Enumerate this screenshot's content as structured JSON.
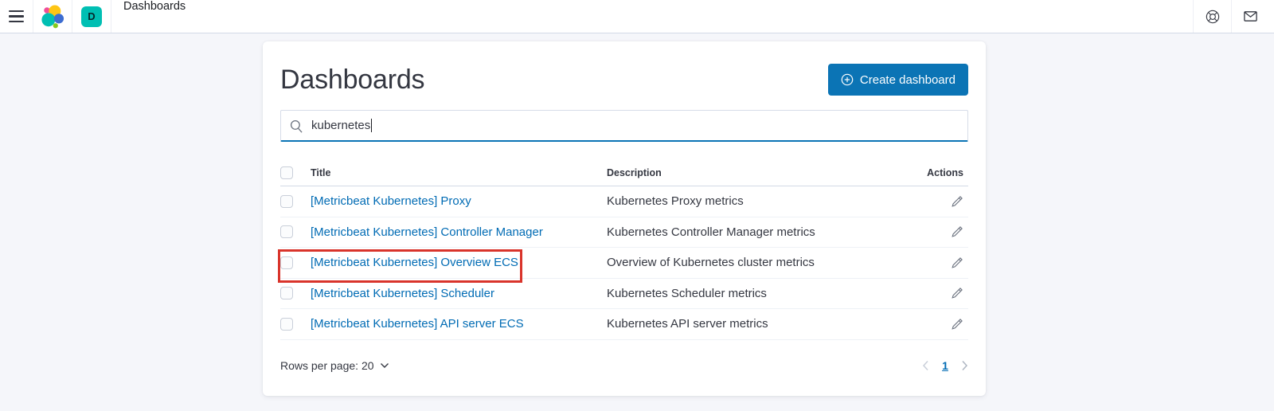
{
  "topbar": {
    "breadcrumb": "Dashboards",
    "space_badge": "D"
  },
  "main": {
    "title": "Dashboards",
    "create_button": "Create dashboard",
    "search_value": "kubernetes"
  },
  "table": {
    "columns": {
      "title": "Title",
      "description": "Description",
      "actions": "Actions"
    },
    "rows": [
      {
        "title": "[Metricbeat Kubernetes] Proxy",
        "description": "Kubernetes Proxy metrics",
        "highlighted": false
      },
      {
        "title": "[Metricbeat Kubernetes] Controller Manager",
        "description": "Kubernetes Controller Manager metrics",
        "highlighted": false
      },
      {
        "title": "[Metricbeat Kubernetes] Overview ECS",
        "description": "Overview of Kubernetes cluster metrics",
        "highlighted": true
      },
      {
        "title": "[Metricbeat Kubernetes] Scheduler",
        "description": "Kubernetes Scheduler metrics",
        "highlighted": false
      },
      {
        "title": "[Metricbeat Kubernetes] API server ECS",
        "description": "Kubernetes API server metrics",
        "highlighted": false
      }
    ]
  },
  "footer": {
    "rows_per_page": "Rows per page: 20",
    "current_page": "1"
  },
  "icons": {
    "menu": "hamburger-icon",
    "logo": "elastic-logo",
    "help": "life-ring-icon",
    "newsfeed": "envelope-icon",
    "create": "plus-circle-icon",
    "search": "magnifier-icon",
    "edit": "pencil-icon",
    "rows_select": "chevron-down-icon",
    "prev_page": "chevron-left-icon",
    "next_page": "chevron-right-icon"
  },
  "colors": {
    "primary_button": "#0b74b5",
    "link": "#006bb4",
    "space_badge": "#00bfb3",
    "annotation": "#d9342b",
    "text": "#343741",
    "border": "#d3dae6",
    "page_background": "#f5f6fa"
  }
}
